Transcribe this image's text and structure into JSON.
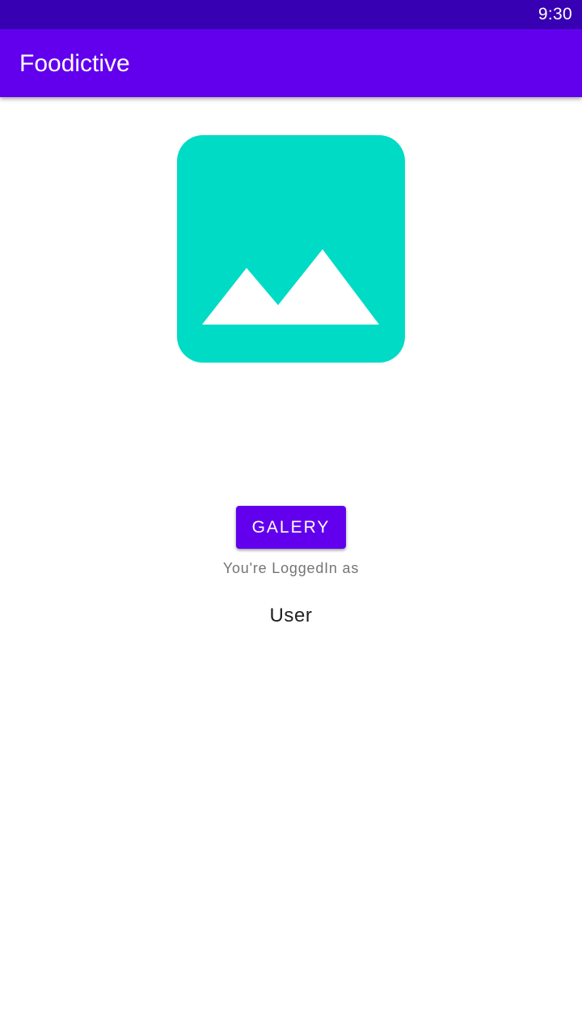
{
  "status_bar": {
    "time": "9:30"
  },
  "app_bar": {
    "title": "Foodictive"
  },
  "image": {
    "icon": "image-placeholder-icon",
    "color": "#00dbc6"
  },
  "main": {
    "galery_button_label": "GALERY",
    "logged_in_label": "You're LoggedIn as",
    "username": "User"
  },
  "colors": {
    "primary": "#6200ee",
    "primary_dark": "#3700b3"
  }
}
